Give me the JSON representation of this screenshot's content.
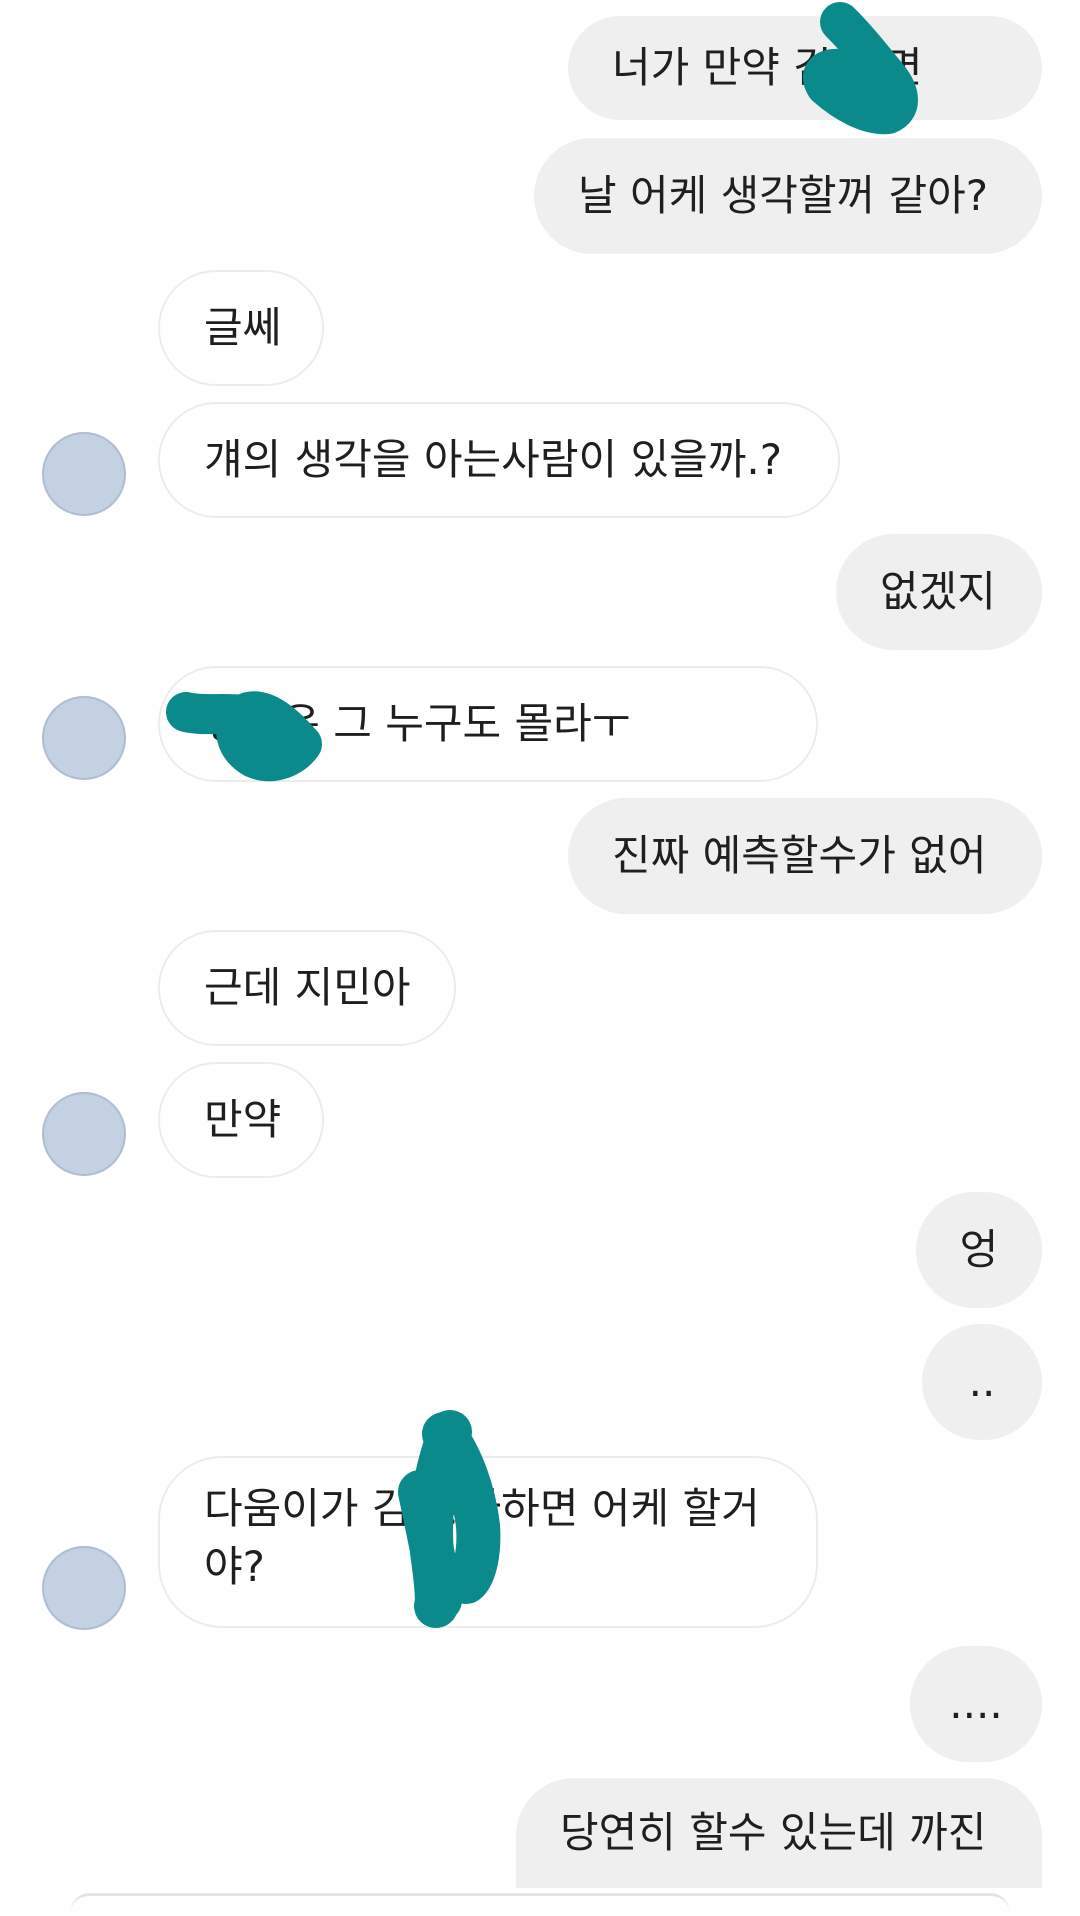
{
  "messages": [
    {
      "id": "m1",
      "side": "me",
      "text": "너가 만약 김  라면"
    },
    {
      "id": "m2",
      "side": "me",
      "text": "날 어케 생각할꺼 같아?"
    },
    {
      "id": "m3",
      "side": "them",
      "text": "글쎄"
    },
    {
      "id": "m4",
      "side": "them",
      "text": "걔의 생각을 아는사람이 있을까.?"
    },
    {
      "id": "m5",
      "side": "me",
      "text": "없겠지"
    },
    {
      "id": "m6",
      "side": "them",
      "text": "   생각은 그 누구도 몰라ㅜ"
    },
    {
      "id": "m7",
      "side": "me",
      "text": "진짜 예측할수가 없어"
    },
    {
      "id": "m8",
      "side": "them",
      "text": "근데 지민아"
    },
    {
      "id": "m9",
      "side": "them",
      "text": "만약"
    },
    {
      "id": "m10",
      "side": "me",
      "text": "엉"
    },
    {
      "id": "m11",
      "side": "me",
      "text": ".."
    },
    {
      "id": "m12",
      "side": "them",
      "text": "다움이가 김  좋아하면 어케 할거야?"
    },
    {
      "id": "m13",
      "side": "me",
      "text": "...."
    },
    {
      "id": "m14",
      "side": "me",
      "text": "당연히 할수 있는데 까진"
    }
  ],
  "colors": {
    "my_bubble": "#efefef",
    "their_bubble": "#ffffff",
    "avatar": "#c3d1e2",
    "scribble": "#0a8a8a"
  }
}
